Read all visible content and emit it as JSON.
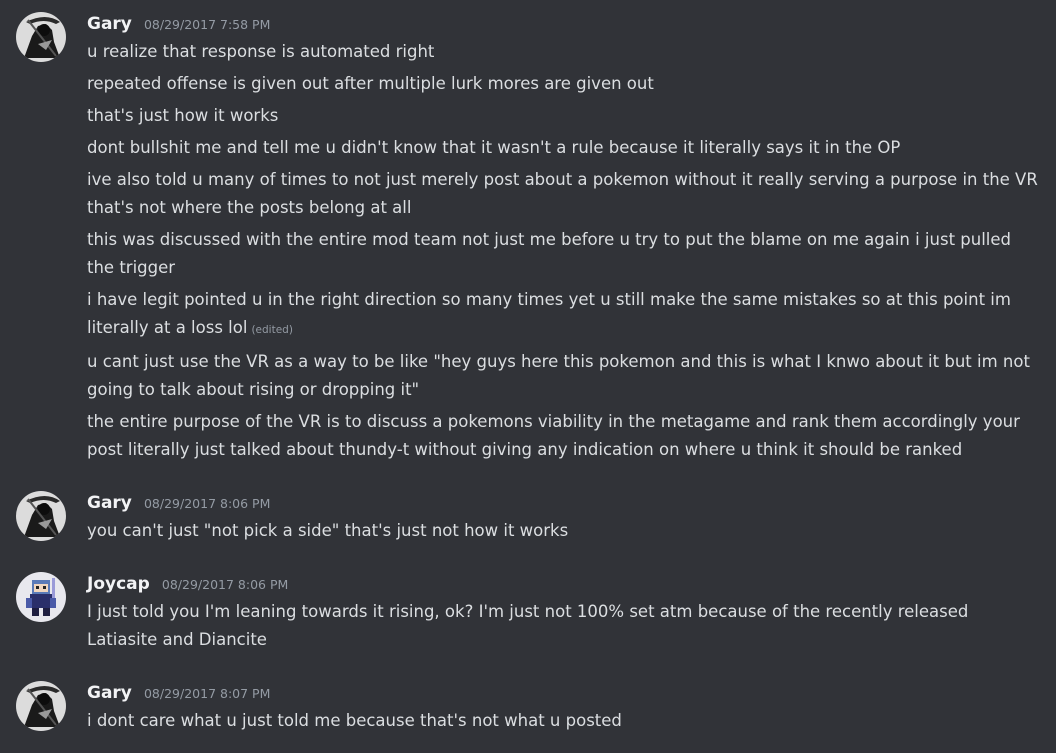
{
  "colors": {
    "background": "#313338",
    "author": "#f2f3f5",
    "text": "#dbdee1",
    "muted": "#949ba4"
  },
  "groups": [
    {
      "author": "Gary",
      "avatar_icon": "reaper-avatar-icon",
      "timestamp": "08/29/2017 7:58 PM",
      "messages": [
        {
          "text": "u realize that response is automated right"
        },
        {
          "text": "repeated offense is given out after multiple lurk mores are given out"
        },
        {
          "text": "that's just how it works"
        },
        {
          "text": "dont bullshit me and tell me u didn't know that it wasn't a rule because it literally says it in the OP"
        },
        {
          "text": "ive also told u many of times to not just merely post about a pokemon without it really serving a purpose in the VR that's not where the posts belong at all"
        },
        {
          "text": "this was discussed with the entire mod team not just me before u try to put the blame on me again i just pulled the trigger"
        },
        {
          "text": "i have legit pointed u in the right direction so many times yet u still make the same mistakes so at this point im literally at a loss lol",
          "edited": "(edited)"
        },
        {
          "text": "u cant just use the VR as a way to be like \"hey guys here this pokemon and this is what I knwo about it but im not going to talk about rising or dropping it\""
        },
        {
          "text": "the entire purpose of the VR is to discuss a pokemons viability in the metagame and rank them accordingly your post literally just talked about thundy-t without giving any indication on where u think it should be ranked"
        }
      ]
    },
    {
      "author": "Gary",
      "avatar_icon": "reaper-avatar-icon",
      "timestamp": "08/29/2017 8:06 PM",
      "messages": [
        {
          "text": "you can't just \"not pick a side\" that's just not how it works"
        }
      ]
    },
    {
      "author": "Joycap",
      "avatar_icon": "pixel-character-avatar-icon",
      "timestamp": "08/29/2017 8:06 PM",
      "messages": [
        {
          "text": "I just told you I'm leaning towards it rising, ok? I'm just not 100% set atm because of the recently released Latiasite and Diancite"
        }
      ]
    },
    {
      "author": "Gary",
      "avatar_icon": "reaper-avatar-icon",
      "timestamp": "08/29/2017 8:07 PM",
      "messages": [
        {
          "text": "i dont care what u just told me because that's not what u posted"
        }
      ]
    }
  ]
}
